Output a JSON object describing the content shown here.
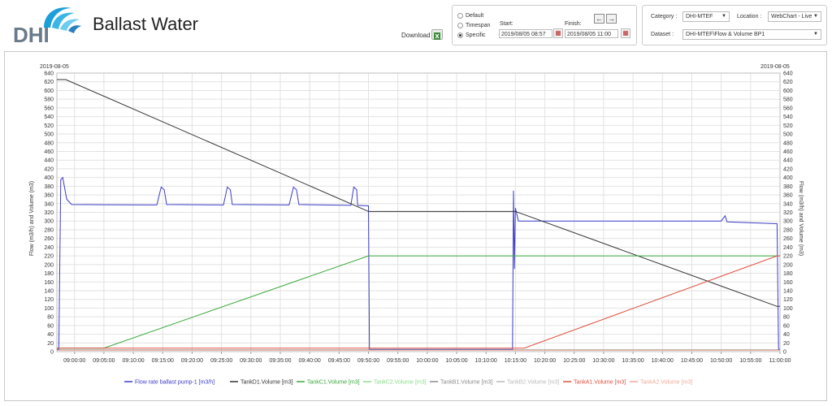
{
  "header": {
    "logo_text": "DHI",
    "app_title": "Ballast Water",
    "download_label": "Download"
  },
  "time_panel": {
    "options": [
      "Default",
      "Timespan",
      "Specific"
    ],
    "selected": "Specific",
    "start_label": "Start:",
    "finish_label": "Finish:",
    "start_value": "2019/08/05 08:57",
    "finish_value": "2019/08/05 11:00",
    "prev_icon": "arrow-left-icon",
    "next_icon": "arrow-right-icon"
  },
  "selectors": {
    "category_label": "Category :",
    "category_value": "DHI-MTEF",
    "location_label": "Location :",
    "location_value": "WebChart - Live",
    "dataset_label": "Dataset :",
    "dataset_value": "DHI-MTEF\\Flow & Volume BP1"
  },
  "colors": {
    "accent_blue": "#3c3cc8",
    "black_series": "#333333",
    "green_series": "#3aa83a",
    "red_series": "#e05040"
  },
  "chart_data": {
    "type": "line",
    "date_left": "2019-08-05",
    "date_right": "2019-08-05",
    "ylabel_left": "Flow (m3/h) and Volume (m3)",
    "ylabel_right": "Flow (m3/h) and Volume (m3)",
    "ylim": [
      0,
      640
    ],
    "yticks": [
      0,
      20,
      40,
      60,
      80,
      100,
      120,
      140,
      160,
      180,
      200,
      220,
      240,
      260,
      280,
      300,
      320,
      340,
      360,
      380,
      400,
      420,
      440,
      460,
      480,
      500,
      520,
      540,
      560,
      580,
      600,
      620,
      640
    ],
    "xlim": [
      "08:57:00",
      "11:00:00"
    ],
    "xticks": [
      "09:00:00",
      "09:05:00",
      "09:10:00",
      "09:15:00",
      "09:20:00",
      "09:25:00",
      "09:30:00",
      "09:35:00",
      "09:40:00",
      "09:45:00",
      "09:50:00",
      "09:55:00",
      "10:00:00",
      "10:05:00",
      "10:10:00",
      "10:15:00",
      "10:20:00",
      "10:25:00",
      "10:30:00",
      "10:35:00",
      "10:40:00",
      "10:45:00",
      "10:50:00",
      "10:55:00",
      "11:00:00"
    ],
    "grid": true,
    "legend_position": "bottom",
    "series": [
      {
        "name": "Flow rate ballast pump-1 [m3/h]",
        "color": "#3c3cc8",
        "points": [
          [
            "08:57:00",
            5
          ],
          [
            "08:57:20",
            5
          ],
          [
            "08:57:40",
            395
          ],
          [
            "08:58:00",
            400
          ],
          [
            "08:58:40",
            350
          ],
          [
            "08:59:30",
            338
          ],
          [
            "09:14:00",
            337
          ],
          [
            "09:14:45",
            378
          ],
          [
            "09:15:15",
            372
          ],
          [
            "09:15:40",
            338
          ],
          [
            "09:25:20",
            337
          ],
          [
            "09:26:00",
            378
          ],
          [
            "09:26:30",
            372
          ],
          [
            "09:26:50",
            338
          ],
          [
            "09:36:30",
            337
          ],
          [
            "09:37:15",
            378
          ],
          [
            "09:37:45",
            372
          ],
          [
            "09:38:10",
            338
          ],
          [
            "09:47:00",
            336
          ],
          [
            "09:47:30",
            378
          ],
          [
            "09:48:00",
            372
          ],
          [
            "09:48:10",
            336
          ],
          [
            "09:50:00",
            335
          ],
          [
            "09:50:10",
            5
          ],
          [
            "10:14:30",
            5
          ],
          [
            "10:14:40",
            370
          ],
          [
            "10:14:50",
            190
          ],
          [
            "10:15:00",
            330
          ],
          [
            "10:15:30",
            300
          ],
          [
            "10:50:00",
            300
          ],
          [
            "10:50:40",
            312
          ],
          [
            "10:51:00",
            298
          ],
          [
            "10:59:00",
            294
          ],
          [
            "10:59:30",
            294
          ],
          [
            "10:59:45",
            5
          ],
          [
            "11:00:00",
            5
          ]
        ]
      },
      {
        "name": "TankD1.Volume [m3]",
        "color": "#333333",
        "points": [
          [
            "08:57:00",
            625
          ],
          [
            "08:58:30",
            625
          ],
          [
            "09:50:00",
            322
          ],
          [
            "10:15:00",
            322
          ],
          [
            "10:59:30",
            104
          ],
          [
            "11:00:00",
            104
          ]
        ]
      },
      {
        "name": "TankC1.Volume [m3]",
        "color": "#3aa83a",
        "points": [
          [
            "08:57:00",
            8
          ],
          [
            "09:05:00",
            8
          ],
          [
            "09:50:00",
            220
          ],
          [
            "11:00:00",
            220
          ]
        ]
      },
      {
        "name": "TankC2.Volume [m3]",
        "color": "#88dd88",
        "points": []
      },
      {
        "name": "TankB1.Volume [m3]",
        "color": "#8a8a8a",
        "points": [
          [
            "08:57:00",
            4
          ],
          [
            "11:00:00",
            4
          ]
        ]
      },
      {
        "name": "TankB2.Volume [m3]",
        "color": "#bbbbbb",
        "points": []
      },
      {
        "name": "TankA1.Volume [m3]",
        "color": "#e05040",
        "points": [
          [
            "08:57:00",
            8
          ],
          [
            "10:16:30",
            8
          ],
          [
            "10:59:30",
            220
          ],
          [
            "11:00:00",
            220
          ]
        ]
      },
      {
        "name": "TankA2.Volume [m3]",
        "color": "#f0a898",
        "points": [
          [
            "08:57:00",
            3
          ],
          [
            "11:00:00",
            3
          ]
        ]
      }
    ]
  }
}
